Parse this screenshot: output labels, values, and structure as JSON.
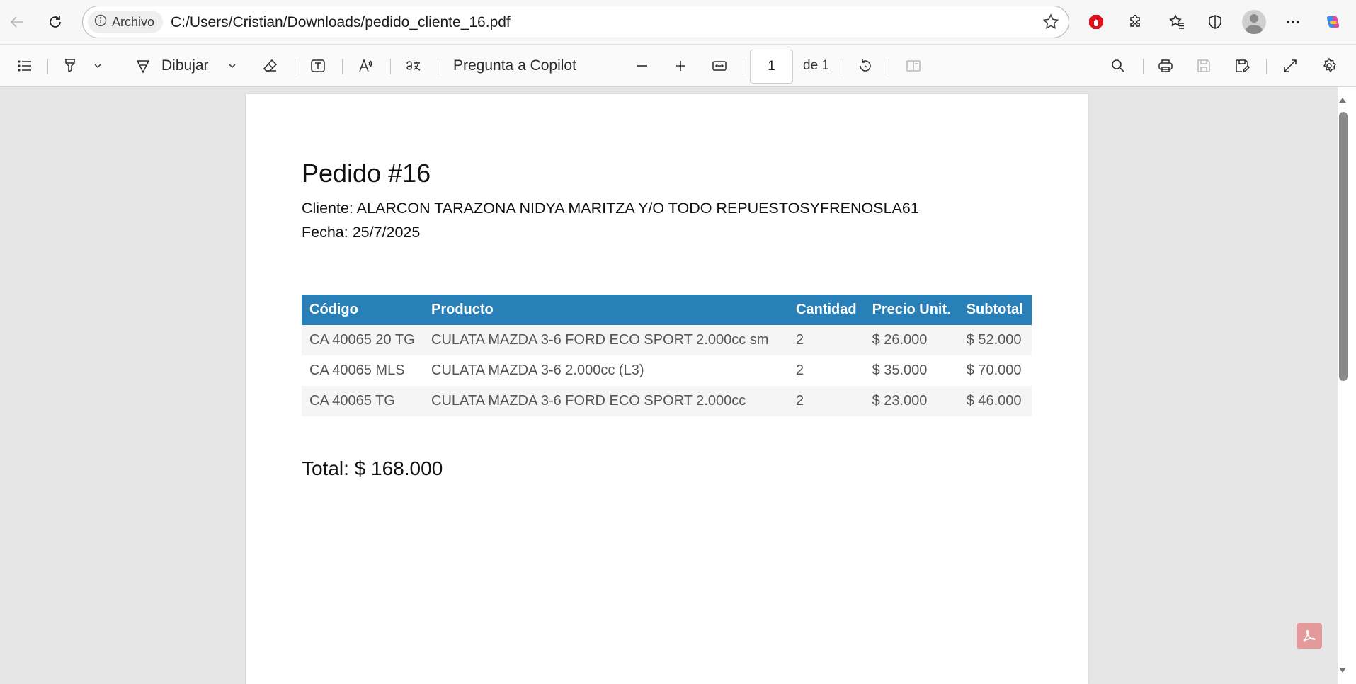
{
  "browser": {
    "address_chip": "Archivo",
    "url": "C:/Users/Cristian/Downloads/pedido_cliente_16.pdf",
    "icons": [
      "back-icon",
      "refresh-icon",
      "info-icon",
      "favorite-star-icon",
      "adblock-icon",
      "extensions-icon",
      "favorites-icon",
      "shield-icon",
      "profile-avatar",
      "more-icon",
      "copilot-icon"
    ]
  },
  "pdf_toolbar": {
    "draw_label": "Dibujar",
    "copilot_label": "Pregunta a Copilot",
    "page_number": "1",
    "page_of": "de 1",
    "icons": [
      "contents-icon",
      "highlight-icon",
      "chevron-down-icon",
      "draw-icon",
      "eraser-icon",
      "text-box-icon",
      "read-aloud-icon",
      "translate-icon",
      "zoom-out-icon",
      "zoom-in-icon",
      "fit-width-icon",
      "rotate-icon",
      "two-page-icon",
      "search-icon",
      "print-icon",
      "save-icon",
      "save-as-icon",
      "fullscreen-icon",
      "settings-icon"
    ]
  },
  "document": {
    "title": "Pedido #16",
    "client_line": "Cliente: ALARCON TARAZONA NIDYA MARITZA Y/O TODO REPUESTOSYFRENOSLA61",
    "date_line": "Fecha: 25/7/2025",
    "table": {
      "header_color": "#2980b9",
      "headers": [
        "Código",
        "Producto",
        "Cantidad",
        "Precio Unit.",
        "Subtotal"
      ],
      "rows": [
        [
          "CA 40065 20 TG",
          "CULATA MAZDA 3-6  FORD  ECO SPORT 2.000cc sm",
          "2",
          "$ 26.000",
          "$ 52.000"
        ],
        [
          "CA 40065 MLS",
          "CULATA  MAZDA 3-6  2.000cc (L3)",
          "2",
          "$ 35.000",
          "$ 70.000"
        ],
        [
          "CA 40065 TG",
          "CULATA MAZDA 3-6  FORD  ECO SPORT 2.000cc",
          "2",
          "$ 23.000",
          "$ 46.000"
        ]
      ]
    },
    "total_line": "Total: $ 168.000"
  }
}
